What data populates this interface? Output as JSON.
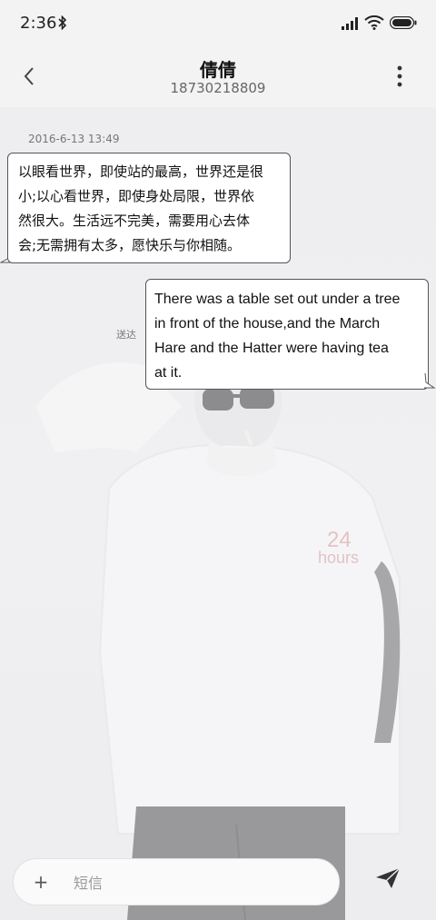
{
  "status_bar": {
    "time": "2:36",
    "icons": [
      "bluetooth-icon",
      "signal-icon",
      "wifi-icon",
      "battery-icon"
    ]
  },
  "header": {
    "back_icon": "chevron-left-icon",
    "contact_name": "倩倩",
    "contact_number": "18730218809",
    "more_icon": "more-vertical-icon"
  },
  "conversation": {
    "timestamp": "2016-6-13 13:49",
    "messages": [
      {
        "direction": "incoming",
        "lines": [
          "以眼看世界，即使站的最高，世界还是很",
          "小;以心看世界，即使身处局限，世界依",
          "然很大。生活远不完美，需要用心去体",
          "会;无需拥有太多，愿快乐与你相随。"
        ]
      },
      {
        "direction": "outgoing",
        "lines": [
          "There was a table set out under a tree",
          "in front of the house,and the March",
          "Hare and the Hatter were having tea",
          "at it."
        ],
        "status": "送达"
      }
    ]
  },
  "background": {
    "sweater_text_line1": "24",
    "sweater_text_line2": "hours",
    "accent_color": "#d99a9a"
  },
  "input_bar": {
    "add_icon": "plus-icon",
    "add_label": "+",
    "placeholder": "短信",
    "value": "",
    "send_icon": "send-icon"
  },
  "colors": {
    "background": "#f3f3f4",
    "bubble": "#ffffff",
    "bubble_border": "#555555",
    "text": "#111111",
    "secondary_text": "#666666"
  }
}
